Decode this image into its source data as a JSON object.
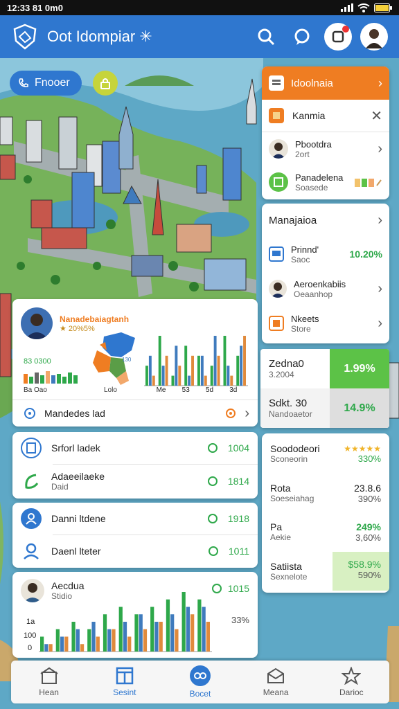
{
  "status_bar": {
    "time": "12:33 81 0m0"
  },
  "app_bar": {
    "title": "Oot Idompiar ✳",
    "icons": [
      "logo-shield",
      "search-icon",
      "chat-icon",
      "notification-icon",
      "avatar"
    ]
  },
  "map": {
    "pill_label": "Fnooer",
    "lock_icon": "lock-icon"
  },
  "menu_panel": {
    "header": "Idoolnaia",
    "items": [
      {
        "label": "Kanmia",
        "icon": "folder-icon",
        "trail": "close"
      },
      {
        "label": "Pbootdra",
        "sub": "2ort",
        "icon": "person-avatar",
        "trail": "chevron"
      },
      {
        "label": "Panadelena",
        "sub": "Soasede",
        "icon": "box-icon",
        "trail": "mini-bars"
      }
    ]
  },
  "right_list": {
    "title": "Manajaioa",
    "items": [
      {
        "label": "Prinnd'",
        "sub": "Saoc",
        "value": "10.20%",
        "icon": "monitor-icon"
      },
      {
        "label": "Aeroenkabiis",
        "sub": "Oeaanhop",
        "icon": "person-avatar"
      },
      {
        "label": "Nkeets",
        "sub": "Store",
        "icon": "box-icon"
      }
    ]
  },
  "right_stats": [
    {
      "label": "Zedna0",
      "sub": "3.2004",
      "value": "1.99%",
      "bg": "#5cc247",
      "value_color": "#ffffff"
    },
    {
      "label": "Sdkt. 30",
      "sub": "Nandoaetor",
      "value": "14.9%",
      "bg": "#dedede",
      "value_color": "#2ea84a"
    }
  ],
  "right_metrics": [
    {
      "label": "Soododeori",
      "sub": "Sconeorin",
      "value": "330%",
      "stars": "★★★★★"
    },
    {
      "label": "Rota",
      "sub": "Soeseiahag",
      "value_top": "23.8.6",
      "value": "390%"
    },
    {
      "label": "Pa",
      "sub": "Aekie",
      "value_top": "249%",
      "value": "3,60%"
    },
    {
      "label": "Satiista",
      "sub": "Sexnelote",
      "value_top": "$58.9%",
      "value": "590%"
    }
  ],
  "dashboard_card": {
    "name": "Nanadebaiagtanh",
    "rating": "★ 20%5%",
    "stat_label": "83 0300",
    "bar_label": "Ba Oao",
    "map_label": "Lolo",
    "chart_labels": [
      "Me",
      "53",
      "5d",
      "3d"
    ],
    "footer": "Mandedes lad"
  },
  "list_card_1": {
    "items": [
      {
        "label": "Srforl ladek",
        "value": "1004"
      },
      {
        "label": "Adaeeilaeke",
        "sub": "Daid",
        "value": "1814"
      }
    ]
  },
  "list_card_2": {
    "items": [
      {
        "label": "Danni ltdene",
        "value": "1918"
      },
      {
        "label": "Daenl lteter",
        "value": "1011"
      }
    ]
  },
  "chart_card": {
    "title": "Aecdua",
    "sub": "Stidio",
    "value": "1015",
    "pct": "33%",
    "y_ticks": [
      "1a",
      "100",
      "0"
    ]
  },
  "chart_data": [
    {
      "type": "bar",
      "title": "",
      "categories": [
        "Me",
        "53",
        "5d",
        "3d"
      ],
      "series": [
        {
          "name": "",
          "values": [
            2,
            5,
            1,
            4,
            3,
            2,
            5,
            3
          ]
        },
        {
          "name": "",
          "values": [
            3,
            2,
            4,
            1,
            3,
            5,
            2,
            4
          ]
        },
        {
          "name": "",
          "values": [
            1,
            3,
            2,
            3,
            1,
            3,
            1,
            5
          ]
        }
      ]
    },
    {
      "type": "bar",
      "title": "",
      "categories": [],
      "y_ticks": [
        "1a",
        "100",
        "0"
      ],
      "series": [
        {
          "name": "",
          "values": [
            2,
            3,
            4,
            3,
            5,
            6,
            5,
            6,
            7,
            8,
            7
          ]
        },
        {
          "name": "",
          "values": [
            1,
            2,
            3,
            4,
            3,
            4,
            5,
            4,
            5,
            6,
            6
          ]
        },
        {
          "name": "",
          "values": [
            1,
            2,
            1,
            2,
            3,
            2,
            3,
            4,
            3,
            5,
            4
          ]
        }
      ]
    }
  ],
  "bottom_nav": [
    {
      "label": "Hean",
      "icon": "home-icon",
      "active": false
    },
    {
      "label": "Sesint",
      "icon": "window-icon",
      "active": true
    },
    {
      "label": "Bocet",
      "icon": "sync-icon",
      "active": true
    },
    {
      "label": "Meana",
      "icon": "mail-icon",
      "active": false
    },
    {
      "label": "Darioc",
      "icon": "star-icon",
      "active": false
    }
  ],
  "colors": {
    "primary": "#2f77cf",
    "green": "#2ea84a",
    "orange": "#ef7d22",
    "panel_bg": "#ffffff"
  }
}
